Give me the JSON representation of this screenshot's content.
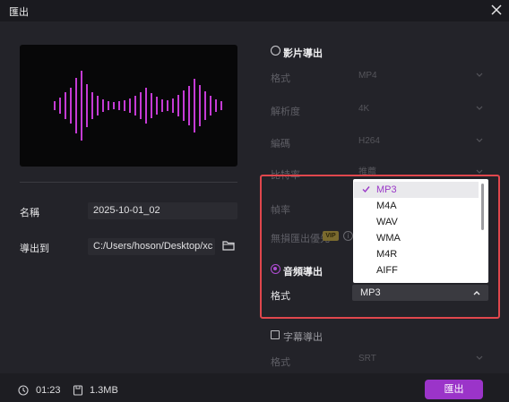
{
  "window": {
    "title": "匯出"
  },
  "left": {
    "name_label": "名稱",
    "name_value": "2025-10-01_02",
    "export_to_label": "導出到",
    "export_path": "C:/Users/hoson/Desktop/xc"
  },
  "video": {
    "section_label": "影片導出",
    "format_label": "格式",
    "format_value": "MP4",
    "resolution_label": "解析度",
    "resolution_value": "4K",
    "codec_label": "編碼",
    "codec_value": "H264",
    "bitrate_label": "比特率",
    "bitrate_value": "推薦",
    "framerate_label": "幀率",
    "lossless_label": "無損匯出優先",
    "vip_badge": "VIP"
  },
  "audio": {
    "section_label": "音頻導出",
    "format_label": "格式",
    "format_value": "MP3",
    "options": [
      "MP3",
      "M4A",
      "WAV",
      "WMA",
      "M4R",
      "AIFF"
    ],
    "selected_index": 0
  },
  "subtitle": {
    "section_label": "字幕導出",
    "format_label": "格式",
    "format_value": "SRT"
  },
  "footer": {
    "duration": "01:23",
    "size": "1.3MB",
    "export_button": "匯出"
  },
  "colors": {
    "accent": "#9b34c9",
    "highlight_border": "#e0474d",
    "waveform": "#c43bd4"
  },
  "icons": {
    "close": "close-icon",
    "folder": "folder-icon",
    "clock": "clock-icon",
    "file": "file-icon",
    "check": "check-icon",
    "info": "info-icon"
  }
}
